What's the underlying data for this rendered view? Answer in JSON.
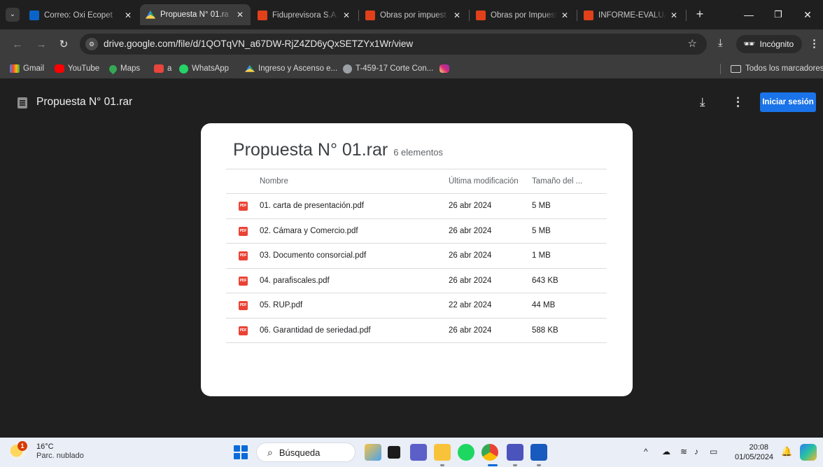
{
  "browser": {
    "tabs": [
      {
        "label": "Correo: Oxi Ecopet",
        "favicon": "outlook-icon",
        "active": false
      },
      {
        "label": "Propuesta N° 01.ra",
        "favicon": "google-drive-icon",
        "active": true
      },
      {
        "label": "Fiduprevisora S.A.",
        "favicon": "fiduprevisora-icon",
        "active": false
      },
      {
        "label": "Obras por impuest",
        "favicon": "fiduprevisora-icon",
        "active": false
      },
      {
        "label": "Obras por Impuest",
        "favicon": "fiduprevisora-icon",
        "active": false
      },
      {
        "label": "INFORME-EVALUA",
        "favicon": "fiduprevisora-icon",
        "active": false
      }
    ],
    "url": "drive.google.com/file/d/1QOTqVN_a67DW-RjZ4ZD6yQxSETZYx1Wr/view",
    "incognito_label": "Incógnito",
    "bookmarks": [
      {
        "label": "Gmail",
        "icon": "gmail-icon"
      },
      {
        "label": "YouTube",
        "icon": "youtube-icon"
      },
      {
        "label": "Maps",
        "icon": "maps-icon"
      },
      {
        "label": "a",
        "icon": "bookmark-a-icon"
      },
      {
        "label": "WhatsApp",
        "icon": "whatsapp-icon"
      },
      {
        "label": "Ingreso y Ascenso e...",
        "icon": "google-drive-icon"
      },
      {
        "label": "T-459-17 Corte Con...",
        "icon": "globe-icon"
      },
      {
        "label": "",
        "icon": "instagram-icon"
      }
    ],
    "all_bookmarks_label": "Todos los marcadores"
  },
  "viewer": {
    "file_title": "Propuesta N° 01.rar",
    "signin_label": "Iniciar sesión",
    "archive": {
      "title": "Propuesta N° 01.rar",
      "count": "6 elementos",
      "headers": {
        "name": "Nombre",
        "modified": "Última modificación",
        "size": "Tamaño del ..."
      },
      "files": [
        {
          "name": "01. carta de presentación.pdf",
          "modified": "26 abr 2024",
          "size": "5 MB"
        },
        {
          "name": "02. Cámara y Comercio.pdf",
          "modified": "26 abr 2024",
          "size": "5 MB"
        },
        {
          "name": "03. Documento consorcial.pdf",
          "modified": "26 abr 2024",
          "size": "1 MB"
        },
        {
          "name": "04. parafiscales.pdf",
          "modified": "26 abr 2024",
          "size": "643 KB"
        },
        {
          "name": "05. RUP.pdf",
          "modified": "22 abr 2024",
          "size": "44 MB"
        },
        {
          "name": "06. Garantidad de seriedad.pdf",
          "modified": "26 abr 2024",
          "size": "588 KB"
        }
      ],
      "file_icon_label": "PDF"
    }
  },
  "taskbar": {
    "weather_temp": "16°C",
    "weather_condition": "Parc. nublado",
    "weather_badge": "1",
    "search_label": "Búsqueda",
    "time": "20:08",
    "date": "01/05/2024"
  },
  "colors": {
    "accent": "#1a73e8",
    "pdf_red": "#ea4335",
    "dark_bg": "#1f1f1f"
  }
}
